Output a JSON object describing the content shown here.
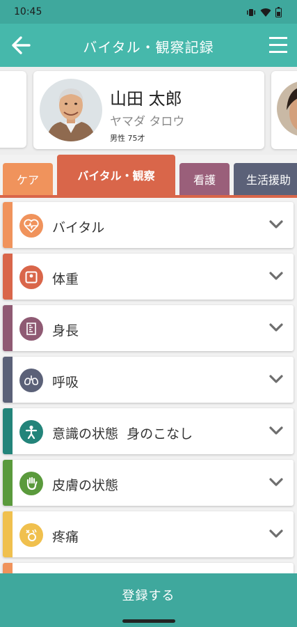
{
  "status": {
    "time": "10:45"
  },
  "header": {
    "title": "バイタル・観察記録",
    "back_icon": "arrow-left-icon",
    "menu_icon": "hamburger-menu-icon"
  },
  "patient": {
    "name": "山田 太郎",
    "kana": "ヤマダ タロウ",
    "meta": "男性 75才"
  },
  "tabs": [
    {
      "label": "ケア",
      "color": "#f0935c"
    },
    {
      "label": "バイタル・観察",
      "color": "#d9664a",
      "selected": true
    },
    {
      "label": "看護",
      "color": "#9a5f7a"
    },
    {
      "label": "生活援助",
      "color": "#5b6178"
    }
  ],
  "items": [
    {
      "label": "バイタル",
      "color": "#f0935c",
      "icon": "heartbeat-icon"
    },
    {
      "label": "体重",
      "color": "#d9664a",
      "icon": "scale-icon"
    },
    {
      "label": "身長",
      "color": "#8f5a73",
      "icon": "height-icon"
    },
    {
      "label": "呼吸",
      "color": "#5b6178",
      "icon": "lungs-icon"
    },
    {
      "label": "意識の状態  身のこなし",
      "color": "#23847a",
      "icon": "person-icon"
    },
    {
      "label": "皮膚の状態",
      "color": "#5a9a3c",
      "icon": "hand-icon"
    },
    {
      "label": "疼痛",
      "color": "#f0c04e",
      "icon": "pain-icon"
    }
  ],
  "footer": {
    "register_label": "登録する"
  }
}
